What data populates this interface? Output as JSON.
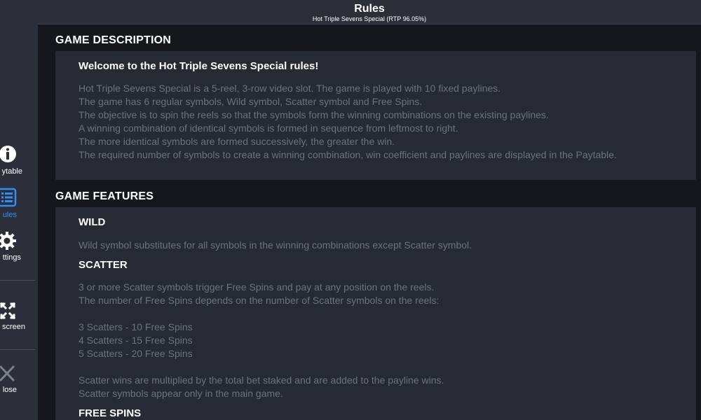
{
  "header": {
    "title": "Rules",
    "subtitle": "Hot Triple Sevens Special (RTP 96.05%)"
  },
  "sidebar": {
    "items": [
      {
        "label": "ytable",
        "icon": "info-icon"
      },
      {
        "label": "ules",
        "icon": "list-icon",
        "active": true
      },
      {
        "label": "ttings",
        "icon": "gear-icon"
      },
      {
        "label": "screen",
        "icon": "fullscreen-icon"
      },
      {
        "label": "lose",
        "icon": "close-icon"
      }
    ]
  },
  "game_description": {
    "heading": "GAME DESCRIPTION",
    "welcome": "Welcome to the Hot Triple Sevens Special rules!",
    "lines": [
      "Hot Triple Sevens Special is a 5-reel, 3-row video slot. The game is played with 10 fixed paylines.",
      "The game has 6 regular symbols, Wild symbol, Scatter symbol and Free Spins.",
      "The objective is to spin the reels so that the symbols form the winning combinations on the existing paylines.",
      "A winning combination of identical symbols is formed in sequence from leftmost to right.",
      "The more identical symbols are formed successively, the greater the win.",
      "The required number of symbols to create a winning combination, win coefficient and paylines are displayed in the Paytable."
    ]
  },
  "game_features": {
    "heading": "GAME FEATURES",
    "wild": {
      "title": "WILD",
      "text": "Wild symbol substitutes for all symbols in the winning combinations except Scatter symbol."
    },
    "scatter": {
      "title": "SCATTER",
      "lines": [
        "3 or more Scatter symbols trigger Free Spins and pay at any position on the reels.",
        "The number of Free Spins depends on the number of Scatter symbols on the reels:",
        "3 Scatters - 10 Free Spins",
        "4 Scatters - 15 Free Spins",
        "5 Scatters - 20 Free Spins",
        "Scatter wins are multiplied by the total bet staked and are added to the payline wins.",
        "Scatter symbols appear only in the main game."
      ]
    },
    "free_spins": {
      "title": "FREE SPINS"
    }
  },
  "colors": {
    "accent": "#2f8ff5",
    "panel": "#252a34",
    "sidebar": "#2a2f3a",
    "body_text": "#6b7280"
  }
}
